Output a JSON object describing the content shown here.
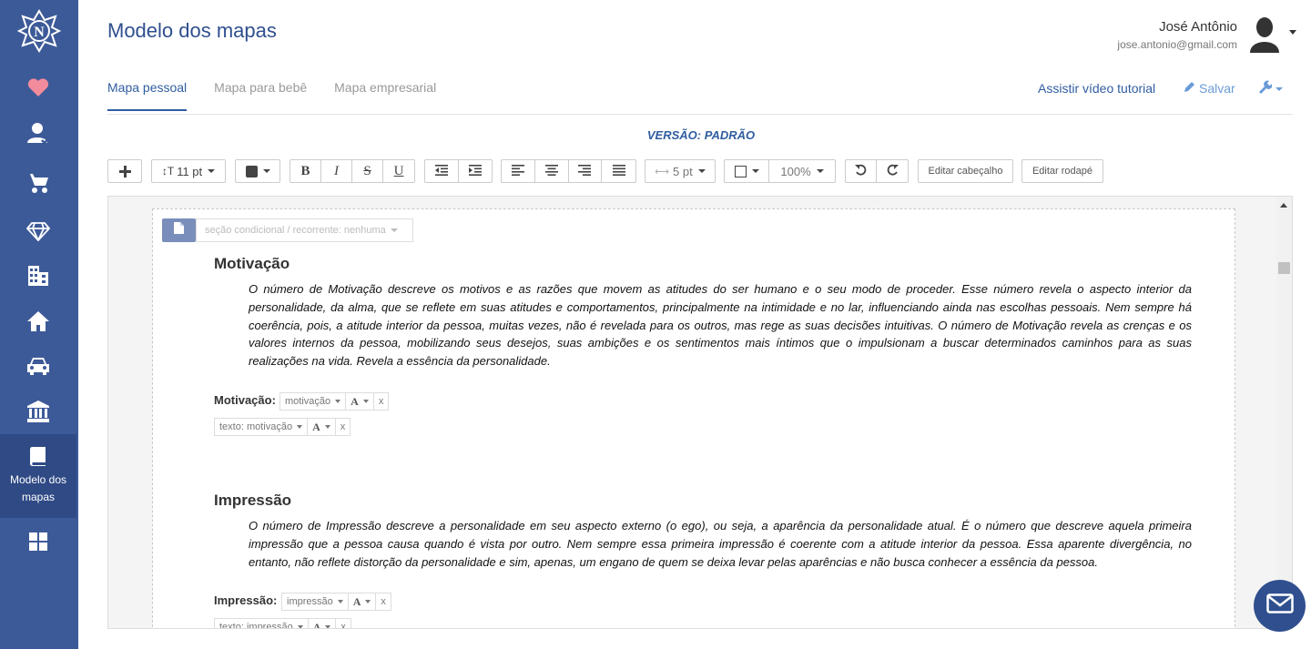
{
  "header": {
    "title": "Modelo dos mapas",
    "user_name": "José Antônio",
    "user_email": "jose.antonio@gmail.com"
  },
  "sidebar": {
    "items": [
      {
        "icon": "heart-icon"
      },
      {
        "icon": "user-icon"
      },
      {
        "icon": "stroller-icon"
      },
      {
        "icon": "diamond-icon"
      },
      {
        "icon": "building-icon"
      },
      {
        "icon": "home-icon"
      },
      {
        "icon": "car-icon"
      },
      {
        "icon": "bank-icon"
      },
      {
        "icon": "book-icon",
        "label": "Modelo dos mapas",
        "active": true
      },
      {
        "icon": "grid-icon"
      }
    ]
  },
  "tabs": [
    {
      "label": "Mapa pessoal",
      "active": true
    },
    {
      "label": "Mapa para bebê"
    },
    {
      "label": "Mapa empresarial"
    }
  ],
  "actions": {
    "tutorial": "Assistir vídeo tutorial",
    "save": "Salvar"
  },
  "version_label": "VERSÃO: PADRÃO",
  "toolbar": {
    "font_size": "11 pt",
    "bold": "B",
    "italic": "I",
    "strike": "S",
    "underline": "U",
    "spacing": "5 pt",
    "zoom": "100%",
    "edit_header": "Editar cabeçalho",
    "edit_footer": "Editar rodapé"
  },
  "editor": {
    "section_select": "seção condicional / recorrente: nenhuma",
    "sections": [
      {
        "title": "Motivação",
        "text": "O número de Motivação descreve os motivos e as razões que movem as atitudes do ser humano e o seu modo de proceder. Esse número revela o aspecto interior da personalidade, da alma, que se reflete em suas atitudes e comportamentos, principalmente na intimidade e no lar, influenciando ainda nas escolhas pessoais. Nem sempre há coerência, pois, a atitude interior da pessoa, muitas vezes, não é revelada para os outros, mas rege as suas decisões intuitivas. O número de Motivação revela as crenças e os valores internos da pessoa, mobilizando seus desejos, suas ambições e os sentimentos mais íntimos que o impulsionam a buscar determinados caminhos para as suas realizações na vida. Revela a essência da personalidade.",
        "field_label": "Motivação:",
        "field_var": "motivação",
        "text_var": "texto: motivação"
      },
      {
        "title": "Impressão",
        "text": "O número de Impressão descreve a personalidade em seu aspecto externo (o ego), ou seja, a aparência da personalidade atual. É o número que descreve aquela primeira impressão que a pessoa causa quando é vista por outro. Nem sempre essa primeira impressão é coerente com a atitude interior da pessoa. Essa aparente divergência, no entanto, não reflete distorção da personalidade e sim, apenas, um engano de quem se deixa levar pelas aparências e não busca conhecer a essência da pessoa.",
        "field_label": "Impressão:",
        "field_var": "impressão",
        "text_var": "texto: impressão"
      }
    ],
    "chip_font": "A",
    "chip_remove": "x"
  }
}
